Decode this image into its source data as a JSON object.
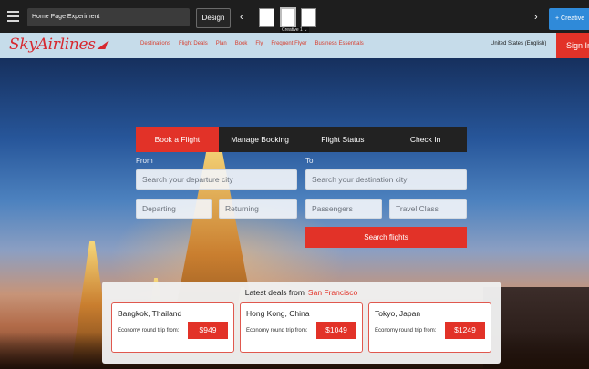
{
  "toolbar": {
    "experiment_name": "Home Page Experiment",
    "design_label": "Design",
    "prev_arrow": "‹",
    "next_arrow": "›",
    "variant_label": "Creative 1 ⌄",
    "creative_button": "+ Creative"
  },
  "site": {
    "logo": "SkyAirlines",
    "nav": [
      "Destinations",
      "Flight Deals",
      "Plan",
      "Book",
      "Fly",
      "Frequent Flyer",
      "Business Essentials"
    ],
    "locale": "United States (English)",
    "sign_in": "Sign In",
    "brand_color": "#e23228"
  },
  "booking": {
    "tabs": [
      {
        "label": "Book a Flight",
        "active": true
      },
      {
        "label": "Manage Booking",
        "active": false
      },
      {
        "label": "Flight Status",
        "active": false
      },
      {
        "label": "Check In",
        "active": false
      }
    ],
    "from_label": "From",
    "to_label": "To",
    "from_placeholder": "Search your departure city",
    "to_placeholder": "Search your destination city",
    "departing": "Departing",
    "returning": "Returning",
    "passengers": "Passengers",
    "travel_class": "Travel Class",
    "search_button": "Search flights"
  },
  "deals": {
    "heading": "Latest deals from",
    "origin": "San Francisco",
    "items": [
      {
        "city": "Bangkok, Thailand",
        "fare_label": "Economy round trip from:",
        "price": "$949"
      },
      {
        "city": "Hong Kong, China",
        "fare_label": "Economy round trip from:",
        "price": "$1049"
      },
      {
        "city": "Tokyo, Japan",
        "fare_label": "Economy round trip from:",
        "price": "$1249"
      }
    ]
  }
}
